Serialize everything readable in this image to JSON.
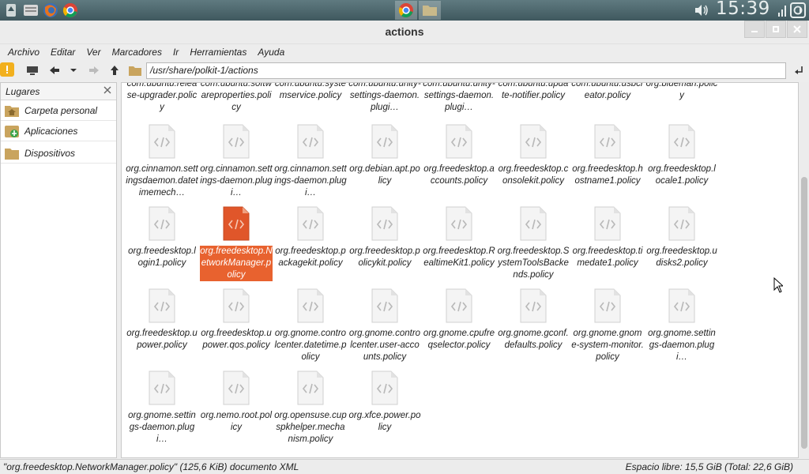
{
  "panel": {
    "clock": "15:39"
  },
  "window": {
    "title": "actions"
  },
  "menu": [
    "Archivo",
    "Editar",
    "Ver",
    "Marcadores",
    "Ir",
    "Herramientas",
    "Ayuda"
  ],
  "toolbar": {
    "location": "/usr/share/polkit-1/actions"
  },
  "sidebar": {
    "header": "Lugares",
    "items": [
      {
        "label": "Carpeta personal",
        "icon": "home-folder-icon"
      },
      {
        "label": "Aplicaciones",
        "icon": "applications-icon"
      },
      {
        "label": "Dispositivos",
        "icon": "folder-icon"
      }
    ]
  },
  "files": [
    "com.ubuntu.release-upgrader.policy",
    "com.ubuntu.softwareproperties.policy",
    "com.ubuntu.systemservice.policy",
    "com.ubuntu.unity-settings-daemon.plugi…",
    "com.ubuntu.unity-settings-daemon.plugi…",
    "com.ubuntu.update-notifier.policy",
    "com.ubuntu.usbcreator.policy",
    "org.blueman.policy",
    "org.cinnamon.settingsdaemon.datetimemech…",
    "org.cinnamon.settings-daemon.plugi…",
    "org.cinnamon.settings-daemon.plugi…",
    "org.debian.apt.policy",
    "org.freedesktop.accounts.policy",
    "org.freedesktop.consolekit.policy",
    "org.freedesktop.hostname1.policy",
    "org.freedesktop.locale1.policy",
    "org.freedesktop.login1.policy",
    "org.freedesktop.NetworkManager.policy",
    "org.freedesktop.packagekit.policy",
    "org.freedesktop.policykit.policy",
    "org.freedesktop.RealtimeKit1.policy",
    "org.freedesktop.SystemToolsBackends.policy",
    "org.freedesktop.timedate1.policy",
    "org.freedesktop.udisks2.policy",
    "org.freedesktop.upower.policy",
    "org.freedesktop.upower.qos.policy",
    "org.gnome.controlcenter.datetime.policy",
    "org.gnome.controlcenter.user-accounts.policy",
    "org.gnome.cpufreqselector.policy",
    "org.gnome.gconf.defaults.policy",
    "org.gnome.gnome-system-monitor.policy",
    "org.gnome.settings-daemon.plugi…",
    "org.gnome.settings-daemon.plugi…",
    "org.nemo.root.policy",
    "org.opensuse.cupspkhelper.mechanism.policy",
    "org.xfce.power.policy"
  ],
  "selected_file": "org.freedesktop.NetworkManager.policy",
  "status": {
    "left": "\"org.freedesktop.NetworkManager.policy\" (125,6 KiB) documento XML",
    "right": "Espacio libre: 15,5 GiB (Total: 22,6 GiB)"
  },
  "colors": {
    "selection": "#e8622f",
    "panel": "#4d676d"
  }
}
